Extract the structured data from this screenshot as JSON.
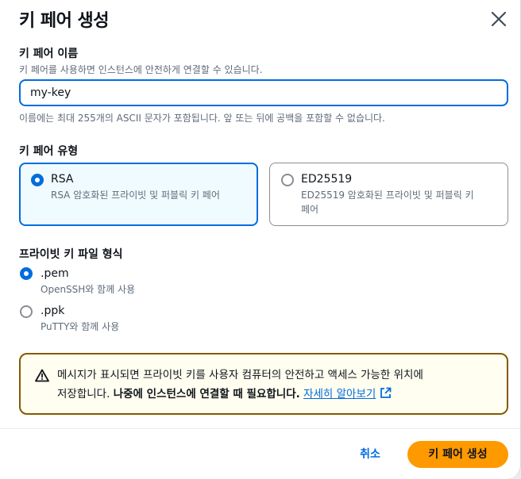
{
  "modal": {
    "title": "키 페어 생성"
  },
  "name_field": {
    "label": "키 페어 이름",
    "description": "키 페어를 사용하면 인스턴스에 안전하게 연결할 수 있습니다.",
    "value": "my-key",
    "constraint": "이름에는 최대 255개의 ASCII 문자가 포함됩니다. 앞 또는 뒤에 공백을 포함할 수 없습니다."
  },
  "key_type": {
    "label": "키 페어 유형",
    "options": [
      {
        "label": "RSA",
        "description": "RSA 암호화된 프라이빗 및 퍼블릭 키 페어",
        "selected": true
      },
      {
        "label": "ED25519",
        "description_line1": "ED25519 암호화된 프라이빗 및 퍼블릭 키",
        "description_line2": "페어",
        "selected": false
      }
    ]
  },
  "file_format": {
    "label": "프라이빗 키 파일 형식",
    "options": [
      {
        "label": ".pem",
        "description": "OpenSSH와 함께 사용",
        "selected": true
      },
      {
        "label": ".ppk",
        "description": "PuTTY와 함께 사용",
        "selected": false
      }
    ]
  },
  "alert": {
    "icon": "warning-icon",
    "line1": "메시지가 표시되면 프라이빗 키를 사용자 컴퓨터의 안전하고 액세스 가능한 위치에",
    "line2_plain": "저장합니다. ",
    "line2_bold": "나중에 인스턴스에 연결할 때 필요합니다.",
    "link": "자세히 알아보기",
    "link_icon": "external-link-icon"
  },
  "footer": {
    "cancel_label": "취소",
    "create_label": "키 페어 생성"
  },
  "colors": {
    "accent": "#006ce0",
    "primary_button": "#ff9900",
    "warning_border": "#855900"
  }
}
